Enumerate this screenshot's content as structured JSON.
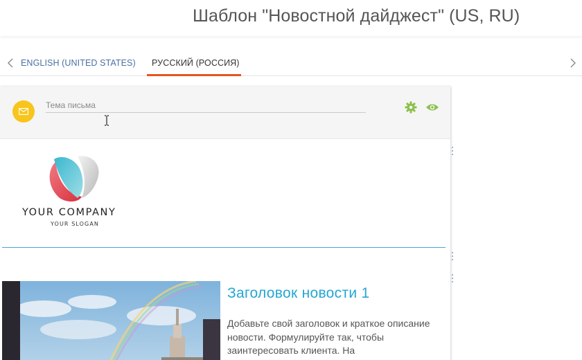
{
  "header": {
    "title": "Шаблон \"Новостной дайджест\" (US, RU)"
  },
  "tabs": {
    "items": [
      {
        "label": "ENGLISH (UNITED STATES)",
        "active": false
      },
      {
        "label": "РУССКИЙ (РОССИЯ)",
        "active": true
      }
    ],
    "prev_icon": "chevron-left-icon",
    "next_icon": "chevron-right-icon",
    "active_underline_color": "#e6541f"
  },
  "subject": {
    "placeholder": "Тема письма",
    "value": "",
    "badge_icon": "envelope-icon",
    "badge_color": "#f7c51c",
    "settings_icon": "gear-icon",
    "preview_icon": "eye-icon",
    "action_color": "#8cc04a"
  },
  "email": {
    "logo": {
      "company": "YOUR COMPANY",
      "slogan": "YOUR SLOGAN"
    },
    "divider_color": "#4aa3d8",
    "news": [
      {
        "title": "Заголовок новости 1",
        "text": "Добавьте свой заголовок и краткое описание новости. Формулируйте так, чтобы заинтересовать клиента. На",
        "title_color": "#23a7d2"
      }
    ]
  }
}
